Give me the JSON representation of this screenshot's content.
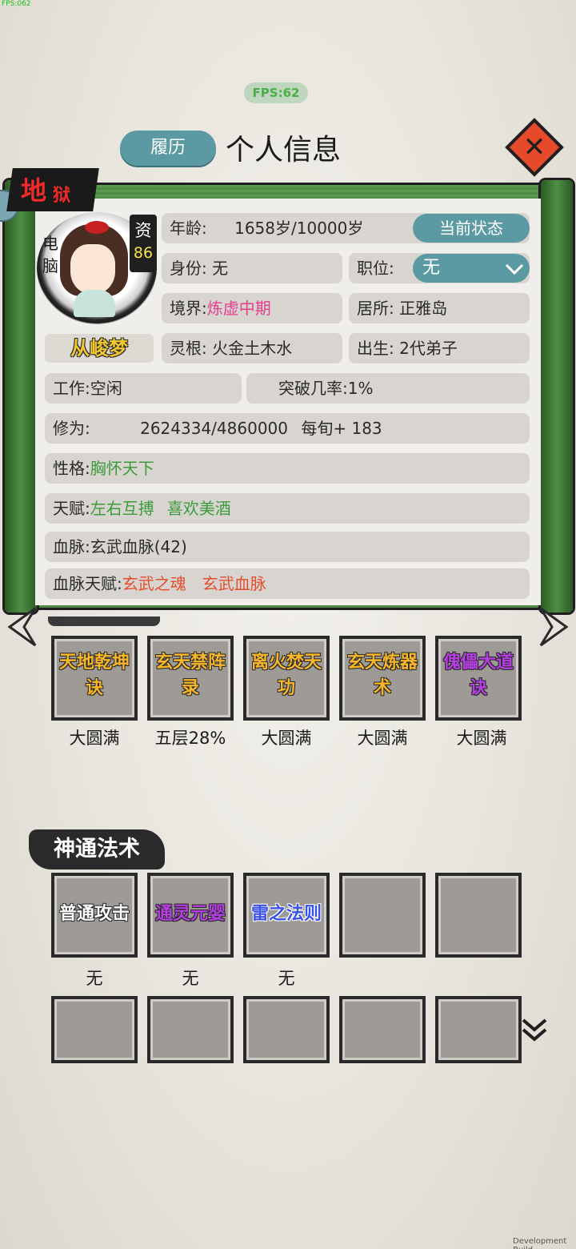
{
  "debug": {
    "fps_corner": "FPS:062",
    "fps_pill": "FPS:62",
    "dev_build": "Development Build"
  },
  "header": {
    "resume_label": "履历",
    "title": "个人信息",
    "close_icon": "close-icon"
  },
  "tag": {
    "di": "地",
    "yu": "狱"
  },
  "character": {
    "control_label": "电脑",
    "aptitude_label": "资",
    "aptitude_value": "86",
    "name": "从峻梦"
  },
  "info": {
    "age_label": "年龄:",
    "age_value": "1658岁/10000岁",
    "status_button": "当前状态",
    "identity": "身份: 无",
    "position_label": "职位:",
    "position_value": "无",
    "realm_label": "境界:",
    "realm_value": "炼虚中期",
    "residence": "居所: 正雅岛",
    "spirit_root": "灵根: 火金土木水",
    "birth": "出生: 2代弟子",
    "work": "工作:空闲",
    "breakthrough": "突破几率:1%",
    "cultivation_label": "修为:",
    "cultivation_value": "2624334/4860000",
    "cultivation_rate": "每旬+ 183",
    "personality_label": "性格:",
    "personality_value": "胸怀天下",
    "talent_label": "天赋:",
    "talent_1": "左右互搏",
    "talent_2": "喜欢美酒",
    "bloodline": "血脉:玄武血脉(42)",
    "bloodline_talent_label": "血脉天赋:",
    "bloodline_talent_1": "玄武之魂",
    "bloodline_talent_2": "玄武血脉"
  },
  "techniques": [
    {
      "name_l1": "天地乾坤",
      "name_l2": "诀",
      "status": "大圆满",
      "color": "gold"
    },
    {
      "name_l1": "玄天禁阵",
      "name_l2": "录",
      "status": "五层28%",
      "color": "gold"
    },
    {
      "name_l1": "离火焚天",
      "name_l2": "功",
      "status": "大圆满",
      "color": "gold"
    },
    {
      "name_l1": "玄天炼器",
      "name_l2": "术",
      "status": "大圆满",
      "color": "gold"
    },
    {
      "name_l1": "傀儡大道",
      "name_l2": "诀",
      "status": "大圆满",
      "color": "purple"
    }
  ],
  "magic_section": {
    "title": "神通法术"
  },
  "magic": [
    {
      "name": "普通攻击",
      "status": "无",
      "color": "white"
    },
    {
      "name": "通灵元婴",
      "status": "无",
      "color": "purple"
    },
    {
      "name": "雷之法则",
      "status": "无",
      "color": "blue"
    }
  ],
  "colors": {
    "accent": "#5c9aa3",
    "scroll_green": "#4f8b44",
    "close_red": "#e74a2b"
  }
}
